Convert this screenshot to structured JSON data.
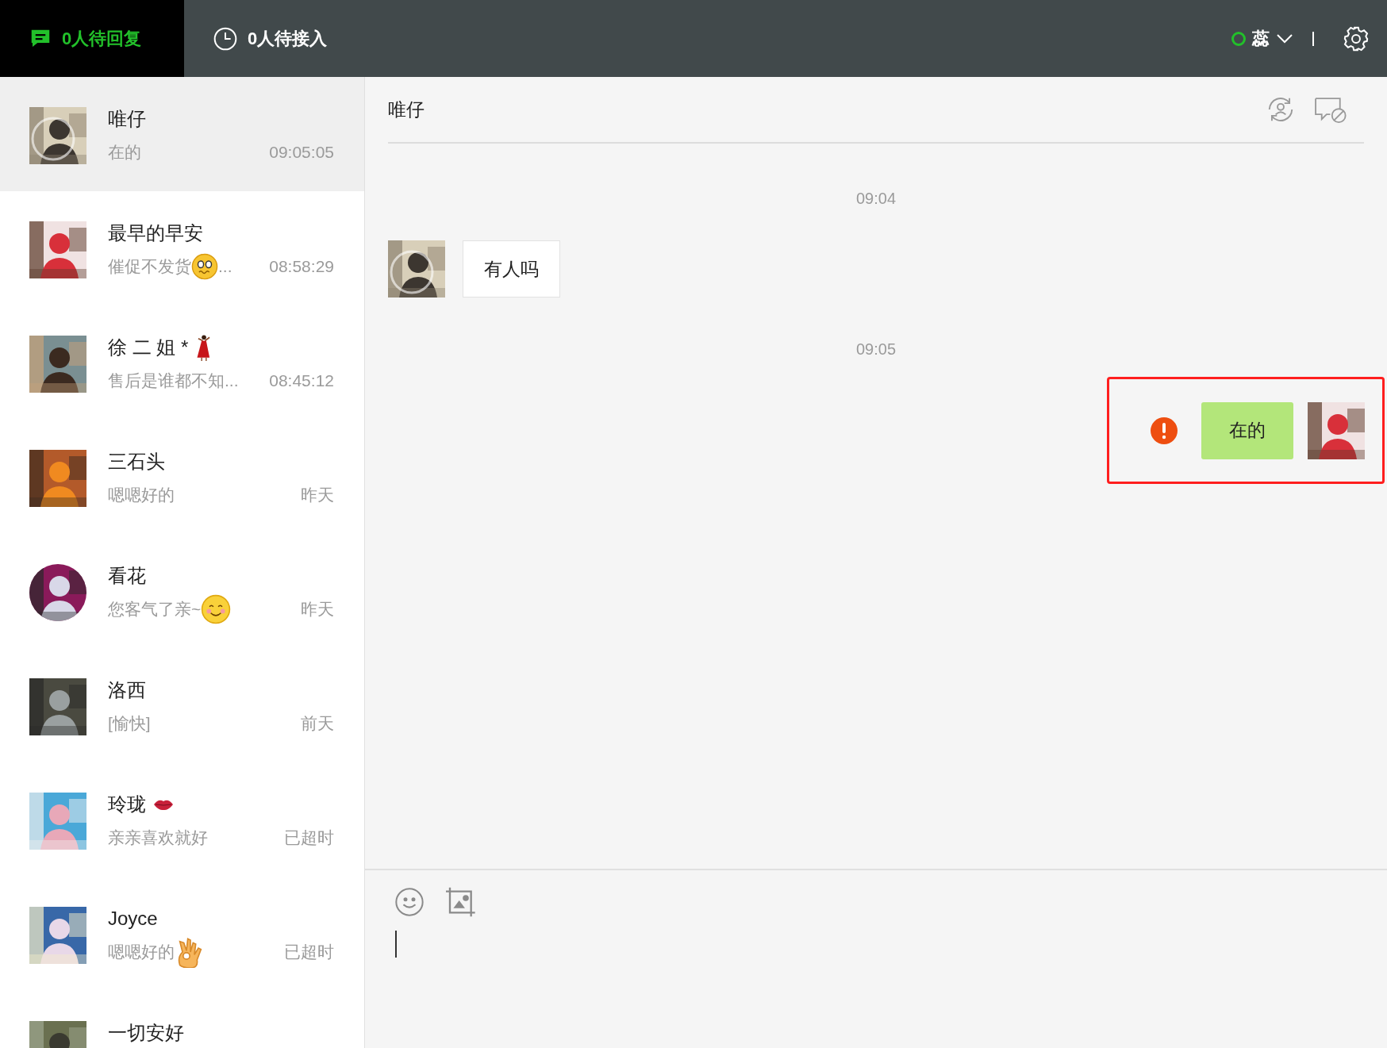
{
  "top_bar": {
    "tabs": [
      {
        "label": "0人待回复",
        "selected": true
      },
      {
        "label": "0人待接入",
        "selected": false
      }
    ],
    "user": {
      "name": "蕊",
      "online": true
    }
  },
  "conversations": [
    {
      "name": "唯仔",
      "preview": "在的",
      "time": "09:05:05",
      "selected": true
    },
    {
      "name": "最早的早安",
      "preview": "催促不发货",
      "preview_suffix": "...",
      "time": "08:58:29",
      "selected": false
    },
    {
      "name": "徐 二 姐 *",
      "preview": "售后是谁都不知...",
      "time": "08:45:12",
      "selected": false
    },
    {
      "name": "三石头",
      "preview": "嗯嗯好的",
      "time": "昨天",
      "selected": false
    },
    {
      "name": "看花",
      "preview": "您客气了亲~",
      "time": "昨天",
      "selected": false
    },
    {
      "name": "洛西",
      "preview": "[愉快]",
      "time": "前天",
      "selected": false
    },
    {
      "name": "玲珑",
      "preview": "亲亲喜欢就好",
      "time": "已超时",
      "selected": false
    },
    {
      "name": "Joyce",
      "preview": "嗯嗯好的",
      "time": "已超时",
      "selected": false
    },
    {
      "name": "一切安好",
      "selected": false
    }
  ],
  "chat": {
    "title": "唯仔",
    "messages": [
      {
        "kind": "time",
        "text": "09:04"
      },
      {
        "kind": "incoming",
        "text": "有人吗"
      },
      {
        "kind": "time",
        "text": "09:05"
      },
      {
        "kind": "outgoing",
        "text": "在的",
        "failed": true,
        "highlighted": true
      }
    ]
  }
}
